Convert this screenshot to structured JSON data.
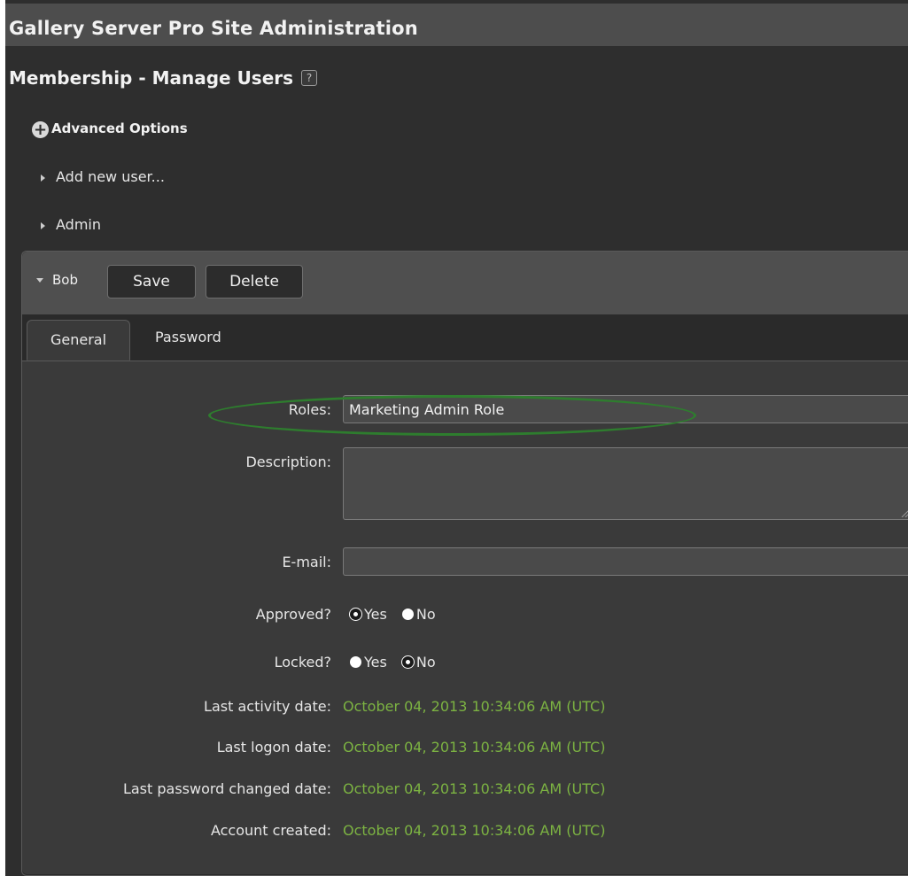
{
  "site_title": "Gallery Server Pro Site Administration",
  "page_heading": "Membership - Manage Users",
  "help_icon_glyph": "?",
  "advanced_options": {
    "icon": "plus-icon",
    "label": "Advanced Options"
  },
  "users": {
    "add_new_label": "Add new user...",
    "admin_label": "Admin",
    "selected_label": "Bob"
  },
  "actions": {
    "save_label": "Save",
    "delete_label": "Delete"
  },
  "tabs": [
    {
      "label": "General",
      "selected": true
    },
    {
      "label": "Password",
      "selected": false
    }
  ],
  "form": {
    "roles_label": "Roles:",
    "roles_value": "Marketing Admin Role",
    "description_label": "Description:",
    "description_value": "",
    "email_label": "E-mail:",
    "email_value": "",
    "approved_label": "Approved?",
    "approved_options": [
      "Yes",
      "No"
    ],
    "approved_selected": "Yes",
    "locked_label": "Locked?",
    "locked_options": [
      "Yes",
      "No"
    ],
    "locked_selected": "No",
    "last_activity_label": "Last activity date:",
    "last_activity_value": "October 04, 2013 10:34:06 AM (UTC)",
    "last_logon_label": "Last logon date:",
    "last_logon_value": "October 04, 2013 10:34:06 AM (UTC)",
    "last_password_changed_label": "Last password changed date:",
    "last_password_changed_value": "October 04, 2013 10:34:06 AM (UTC)",
    "account_created_label": "Account created:",
    "account_created_value": "October 04, 2013 10:34:06 AM (UTC)"
  },
  "colors": {
    "page_background": "#2e2e2e",
    "header_bar": "#4d4d4d",
    "date_value_text": "#7cb342",
    "highlight_ellipse": "#2e7d2e"
  }
}
